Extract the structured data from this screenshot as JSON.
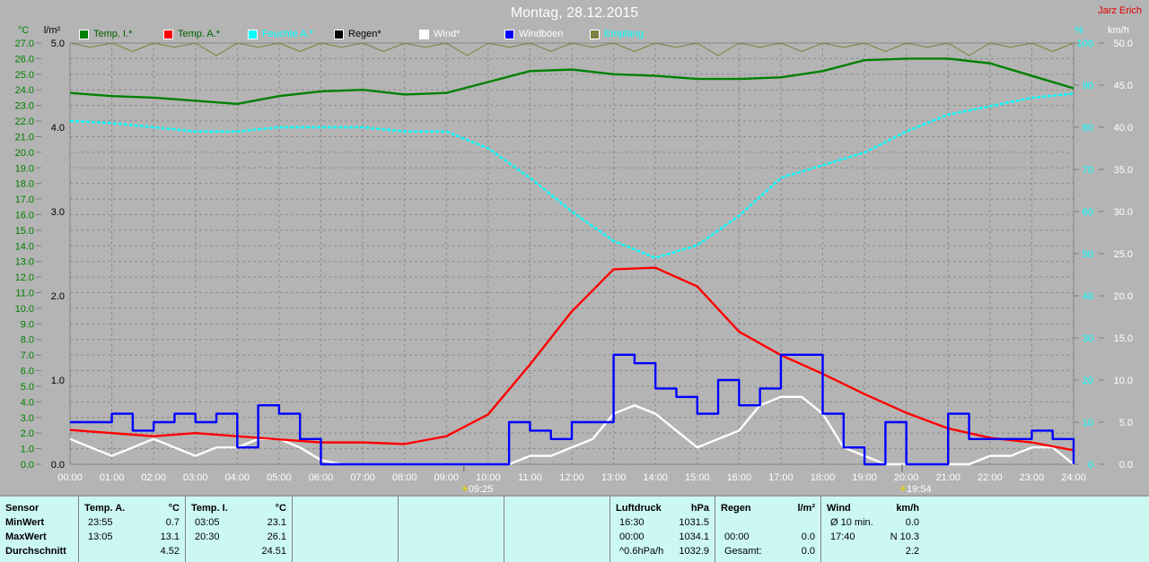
{
  "header": {
    "title": "Montag, 28.12.2015",
    "author": "Jarz Erich"
  },
  "legend": [
    {
      "label": "Temp. I.*",
      "color": "#008000",
      "text_color": "#006000"
    },
    {
      "label": "Temp. A.*",
      "color": "#ff0000",
      "text_color": "#006000"
    },
    {
      "label": "Feuchte A.*",
      "color": "#00ffff",
      "text_color": "#00ffff"
    },
    {
      "label": "Regen*",
      "color": "#000000",
      "text_color": "#000000"
    },
    {
      "label": "Wind*",
      "color": "#ffffff",
      "text_color": "#ffffff"
    },
    {
      "label": "Windböen",
      "color": "#0000ff",
      "text_color": "#ffffff"
    },
    {
      "label": "Empfang",
      "color": "#808040",
      "text_color": "#00ffff"
    }
  ],
  "chart_data": {
    "type": "line",
    "title": "Montag, 28.12.2015",
    "axes": {
      "temp": {
        "unit": "°C",
        "range": [
          0,
          27
        ],
        "step": 1,
        "color": "#008000"
      },
      "rain": {
        "unit": "l/m²",
        "range": [
          0,
          5
        ],
        "step": 1,
        "color": "#000000"
      },
      "humidity": {
        "unit": "%",
        "range": [
          0,
          100
        ],
        "step": 10,
        "color": "#00ffff"
      },
      "wind": {
        "unit": "km/h",
        "range": [
          0,
          50
        ],
        "step": 5,
        "color": "#ffffff"
      }
    },
    "x_ticks": [
      "00:00",
      "01:00",
      "02:00",
      "03:00",
      "04:00",
      "05:00",
      "06:00",
      "07:00",
      "08:00",
      "09:00",
      "10:00",
      "11:00",
      "12:00",
      "13:00",
      "14:00",
      "15:00",
      "16:00",
      "17:00",
      "18:00",
      "19:00",
      "20:00",
      "21:00",
      "22:00",
      "23:00",
      "24:00"
    ],
    "markers": [
      {
        "label": "09:25",
        "hour": 9.42
      },
      {
        "label": "19:54",
        "hour": 19.9
      }
    ],
    "series": [
      {
        "name": "Temp. I.*",
        "axis": "temp",
        "color": "#008000",
        "step_h": 1,
        "values": [
          23.8,
          23.6,
          23.5,
          23.3,
          23.1,
          23.6,
          23.9,
          24.0,
          23.7,
          23.8,
          24.5,
          25.2,
          25.3,
          25.0,
          24.9,
          24.7,
          24.7,
          24.8,
          25.2,
          25.9,
          26.0,
          26.0,
          25.7,
          24.9,
          24.1
        ]
      },
      {
        "name": "Temp. A.*",
        "axis": "temp",
        "color": "#ff0000",
        "step_h": 1,
        "values": [
          2.2,
          2.0,
          1.8,
          2.0,
          1.8,
          1.6,
          1.4,
          1.4,
          1.3,
          1.8,
          3.2,
          6.4,
          9.8,
          12.5,
          12.6,
          11.4,
          8.5,
          7.0,
          5.8,
          4.5,
          3.3,
          2.3,
          1.7,
          1.4,
          0.9
        ]
      },
      {
        "name": "Feuchte A.*",
        "axis": "humidity",
        "color": "#00ffff",
        "step_h": 1,
        "dashed": true,
        "values": [
          81.5,
          81,
          80,
          79,
          79,
          80,
          80,
          80,
          79,
          79,
          75,
          68,
          60,
          53,
          49,
          52,
          59,
          68,
          71,
          74,
          79,
          83,
          85,
          87,
          88
        ]
      },
      {
        "name": "Wind*",
        "axis": "wind",
        "color": "#ffffff",
        "step_h": 0.5,
        "values": [
          3,
          2,
          1,
          2,
          3,
          2,
          1,
          2,
          2,
          3,
          3,
          2,
          0.5,
          0,
          0,
          0,
          0,
          0,
          0,
          0,
          0,
          0,
          1,
          1,
          2,
          3,
          6,
          7,
          6,
          4,
          2,
          3,
          4,
          7,
          8,
          8,
          6,
          2,
          1,
          0,
          0,
          0,
          0,
          0,
          1,
          1,
          2,
          2,
          0
        ]
      },
      {
        "name": "Windböen",
        "axis": "wind",
        "color": "#0000ff",
        "step": true,
        "step_h": 0.5,
        "values": [
          5,
          5,
          6,
          4,
          5,
          6,
          5,
          6,
          2,
          7,
          6,
          3,
          0,
          0,
          0,
          0,
          0,
          0,
          0,
          0,
          0,
          5,
          4,
          3,
          5,
          5,
          13,
          12,
          9,
          8,
          6,
          10,
          7,
          9,
          13,
          13,
          6,
          2,
          0,
          5,
          0,
          0,
          6,
          3,
          3,
          3,
          4,
          3,
          0
        ]
      },
      {
        "name": "Empfang",
        "axis": "humidity",
        "color": "#808040",
        "step_h": 0.5,
        "values": [
          100,
          99,
          100,
          98,
          100,
          99,
          100,
          97,
          100,
          99,
          100,
          98,
          100,
          99,
          100,
          98,
          100,
          99,
          100,
          97,
          100,
          99,
          100,
          98,
          100,
          99,
          100,
          98,
          100,
          99,
          100,
          97,
          100,
          99,
          100,
          98,
          100,
          99,
          100,
          98,
          100,
          99,
          100,
          97,
          100,
          99,
          100,
          98,
          100
        ]
      }
    ]
  },
  "table": {
    "sensor": {
      "header": "Sensor",
      "rows": [
        "MinWert",
        "MaxWert",
        "Durchschnitt"
      ]
    },
    "temp_a": {
      "header": "Temp. A.",
      "unit": "°C",
      "rows": [
        [
          "23:55",
          "0.7"
        ],
        [
          "13:05",
          "13.1"
        ],
        [
          "",
          "4.52"
        ]
      ]
    },
    "temp_i": {
      "header": "Temp. I.",
      "unit": "°C",
      "rows": [
        [
          "03:05",
          "23.1"
        ],
        [
          "20:30",
          "26.1"
        ],
        [
          "",
          "24.51"
        ]
      ]
    },
    "pressure": {
      "header": "Luftdruck",
      "unit": "hPa",
      "rows": [
        [
          "16:30",
          "1031.5"
        ],
        [
          "00:00",
          "1034.1"
        ],
        [
          "^0.6hPa/h",
          "1032.9"
        ]
      ]
    },
    "rain": {
      "header": "Regen",
      "unit": "l/m²",
      "rows": [
        [
          "",
          ""
        ],
        [
          "00:00",
          "0.0"
        ],
        [
          "Gesamt:",
          "0.0"
        ]
      ]
    },
    "wind": {
      "header": "Wind",
      "unit": "km/h",
      "rows": [
        [
          "Ø 10 min.",
          "0.0"
        ],
        [
          "17:40",
          "N 10.3"
        ],
        [
          "",
          "2.2"
        ]
      ]
    }
  }
}
